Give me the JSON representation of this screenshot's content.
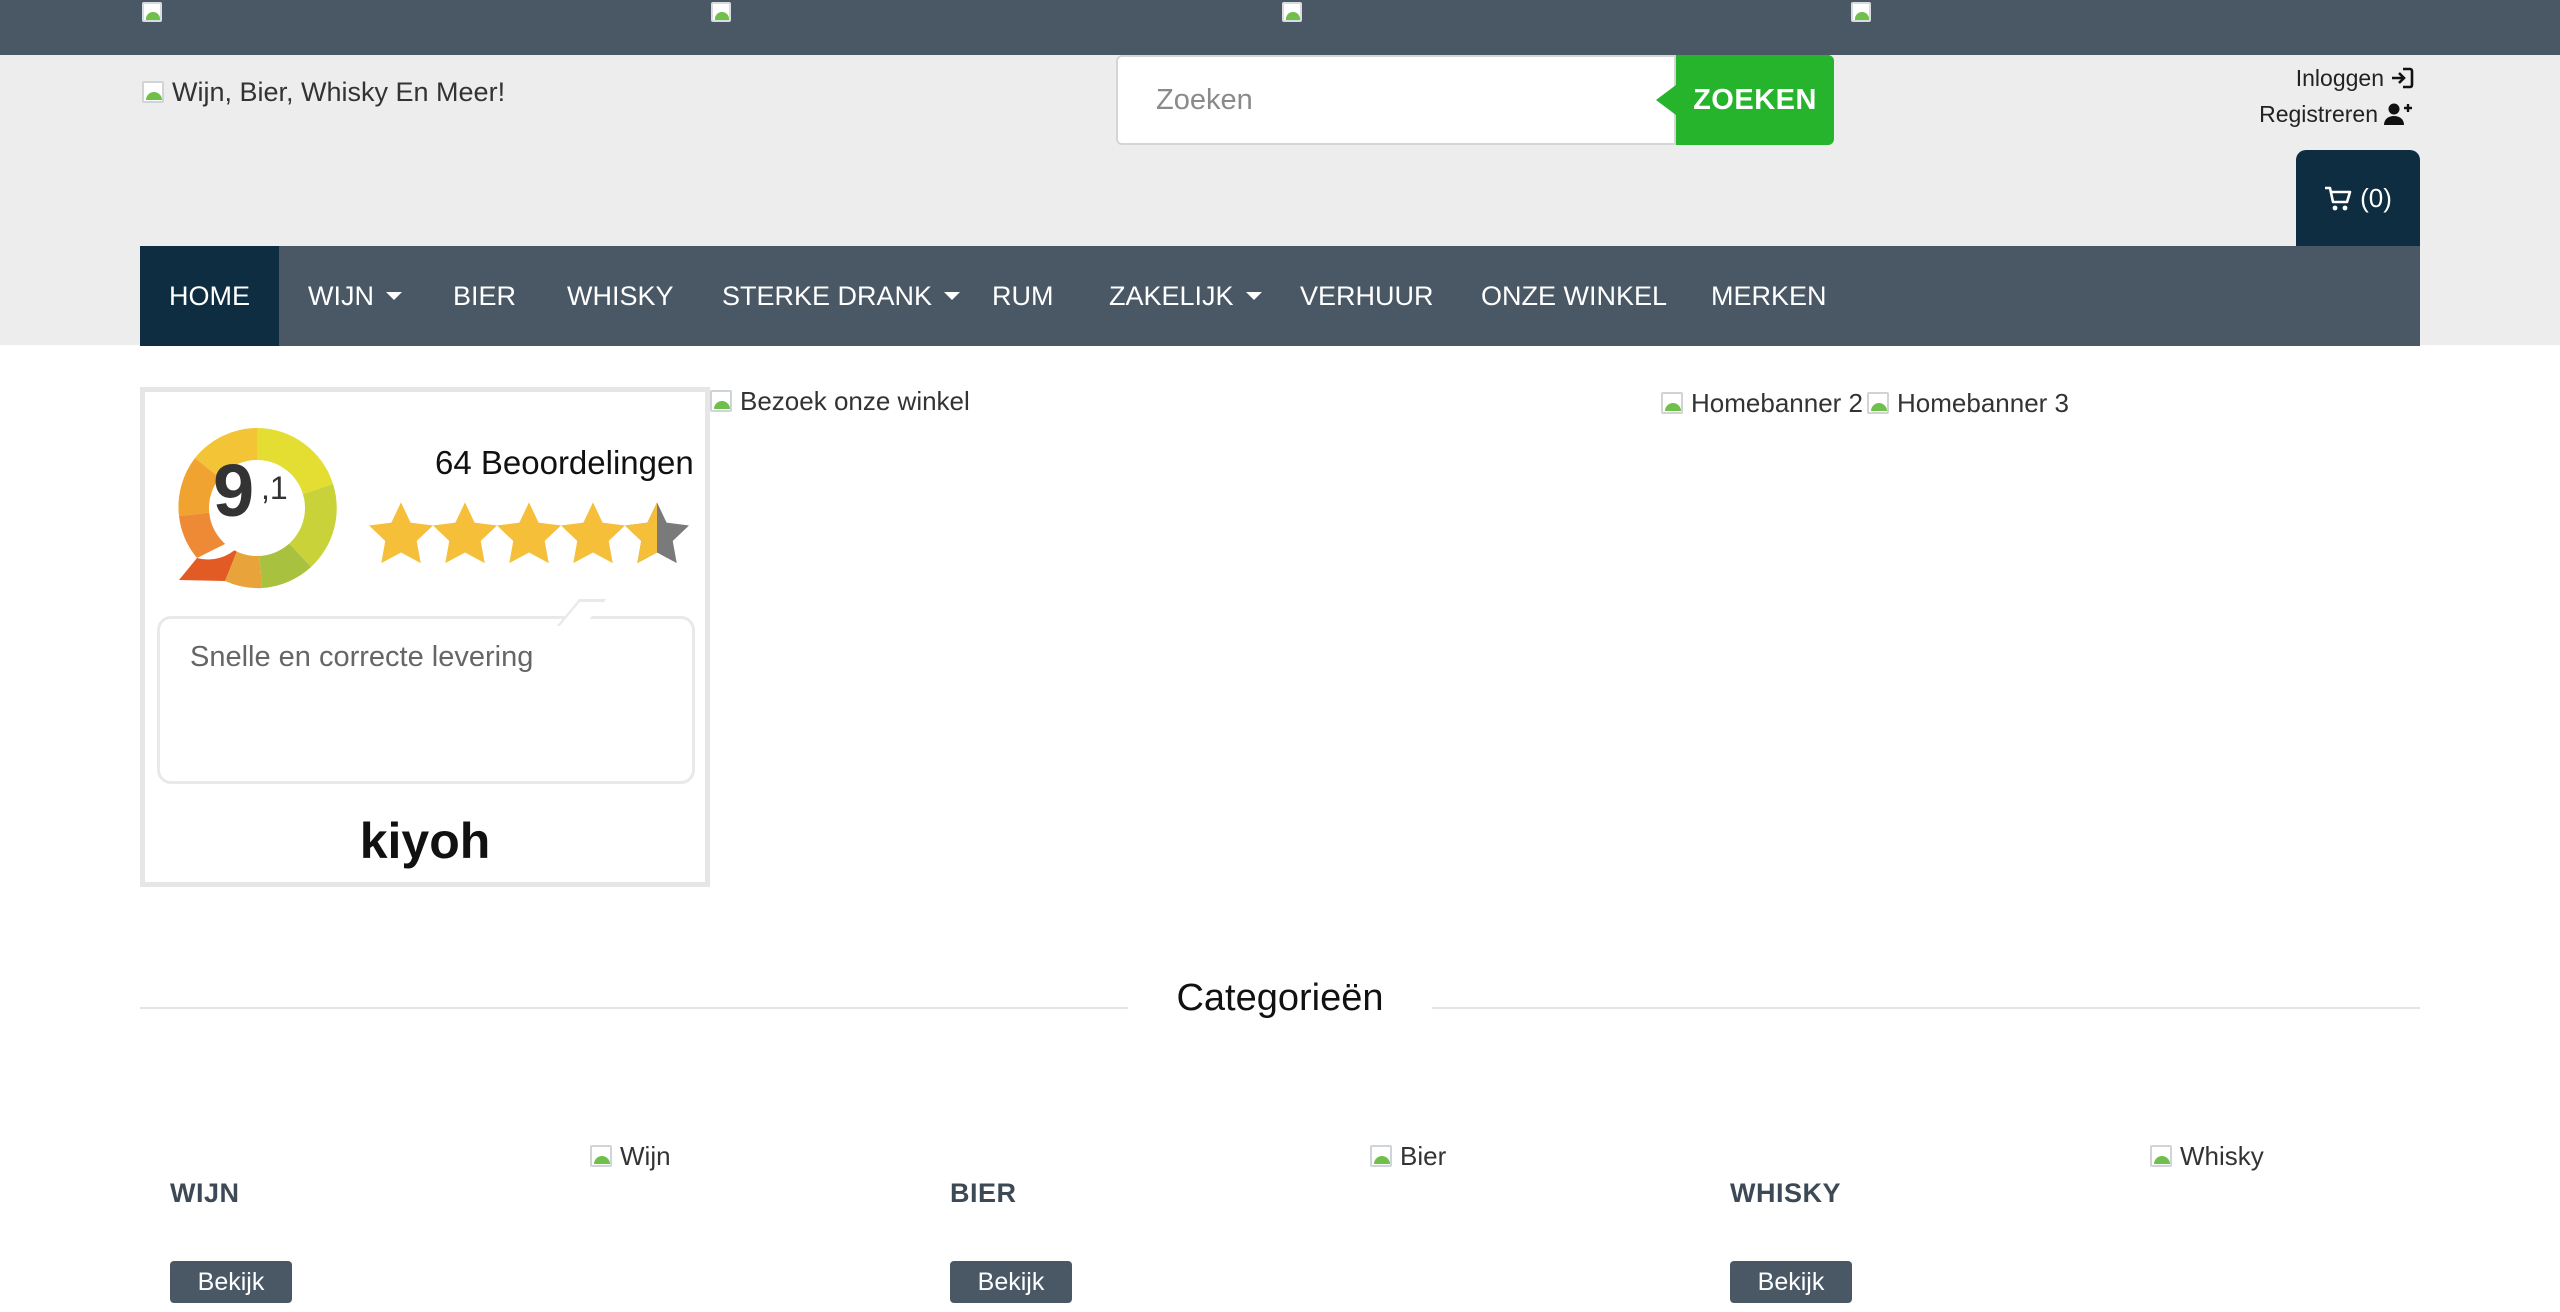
{
  "header": {
    "logo_alt": "Wijn, Bier, Whisky En Meer!",
    "search": {
      "placeholder": "Zoeken",
      "button_label": "ZOEKEN"
    },
    "account": {
      "login_label": "Inloggen",
      "register_label": "Registreren"
    },
    "cart": {
      "count_label": "(0)"
    }
  },
  "nav": {
    "items": [
      {
        "label": "HOME",
        "active": true,
        "dropdown": false
      },
      {
        "label": "WIJN",
        "active": false,
        "dropdown": true
      },
      {
        "label": "BIER",
        "active": false,
        "dropdown": false
      },
      {
        "label": "WHISKY",
        "active": false,
        "dropdown": false
      },
      {
        "label": "STERKE DRANK",
        "active": false,
        "dropdown": true
      },
      {
        "label": "RUM",
        "active": false,
        "dropdown": false
      },
      {
        "label": "ZAKELIJK",
        "active": false,
        "dropdown": true
      },
      {
        "label": "VERHUUR",
        "active": false,
        "dropdown": false
      },
      {
        "label": "ONZE WINKEL",
        "active": false,
        "dropdown": false
      },
      {
        "label": "MERKEN",
        "active": false,
        "dropdown": false
      }
    ]
  },
  "review_widget": {
    "score_main": "9",
    "score_decimal": ",1",
    "reviews_count": "64 Beoordelingen",
    "rating_stars": 4.5,
    "quote": "Snelle en correcte levering",
    "brand": "kiyoh"
  },
  "banners": {
    "visit_store_alt": "Bezoek onze winkel",
    "homebanner2_alt": "Homebanner 2",
    "homebanner3_alt": "Homebanner 3"
  },
  "categories": {
    "title": "Categorieën",
    "items": [
      {
        "label": "WIJN",
        "image_alt": "Wijn",
        "button": "Bekijk"
      },
      {
        "label": "BIER",
        "image_alt": "Bier",
        "button": "Bekijk"
      },
      {
        "label": "WHISKY",
        "image_alt": "Whisky",
        "button": "Bekijk"
      }
    ]
  },
  "colors": {
    "dark_slate": "#4a5866",
    "navy": "#0e2d41",
    "green": "#25b42b",
    "header_bg": "#ededed"
  }
}
